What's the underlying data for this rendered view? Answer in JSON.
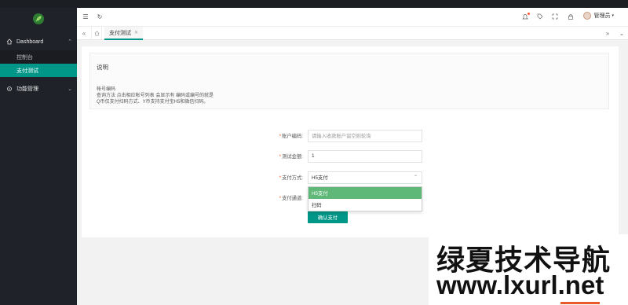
{
  "sidebar": {
    "groups": [
      {
        "label": "Dashboard",
        "items": [
          "控制台",
          "支付测试"
        ]
      },
      {
        "label": "功能管理"
      }
    ],
    "active_item": "支付测试"
  },
  "header": {
    "user_name": "管理员",
    "icons": [
      "menu-icon",
      "refresh-icon",
      "notification-icon",
      "tag-icon",
      "fullscreen-icon",
      "lock-icon"
    ]
  },
  "tabs": {
    "active_label": "支付测试"
  },
  "note": {
    "title": "说明",
    "lines": [
      "帐号编码",
      "查询方法 点击相应帐号列表 会显示有 编码或编号的就是",
      "Q币仅支付扫码方式、Y币支持支付宝H5和微信扫码。"
    ]
  },
  "form": {
    "account_label": "账户编码:",
    "account_placeholder": "请输入收款账户留空则轮询",
    "amount_label": "测试金额:",
    "amount_value": "1",
    "method_label": "支付方式:",
    "method_value": "H5支付",
    "method_options": [
      "H5支付",
      "扫码"
    ],
    "channel_label": "支付通道:",
    "submit_label": "确认支付"
  },
  "watermark": {
    "line1": "绿夏技术导航",
    "line2": "www.lxurl.net"
  },
  "colors": {
    "accent": "#009688",
    "selected_option": "#5FB878",
    "sidebar_bg": "#20222A"
  }
}
